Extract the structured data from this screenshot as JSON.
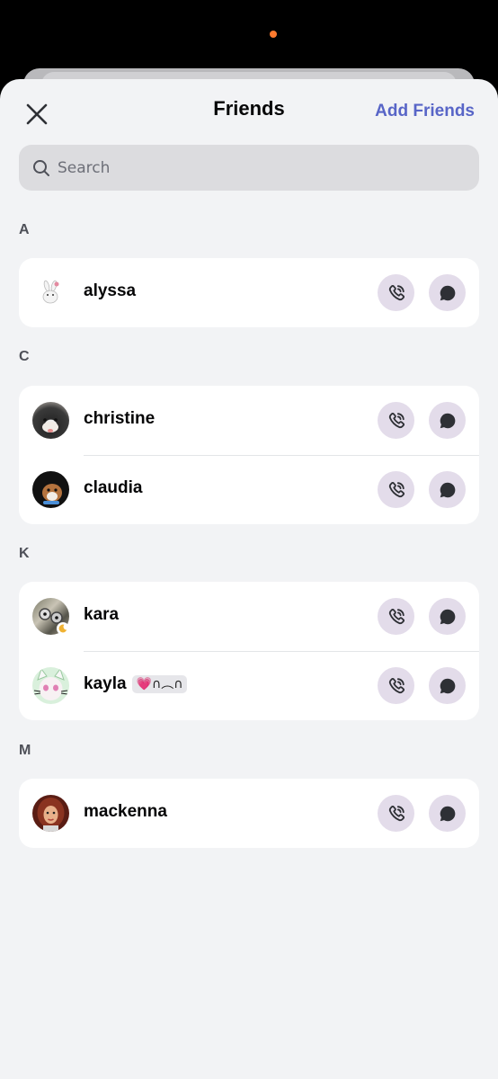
{
  "header": {
    "title": "Friends",
    "add_friends_label": "Add Friends"
  },
  "search": {
    "placeholder": "Search"
  },
  "sections": [
    {
      "letter": "A",
      "friends": [
        {
          "name": "alyssa"
        }
      ]
    },
    {
      "letter": "C",
      "friends": [
        {
          "name": "christine"
        },
        {
          "name": "claudia"
        }
      ]
    },
    {
      "letter": "K",
      "friends": [
        {
          "name": "kara",
          "status": "idle"
        },
        {
          "name": "kayla",
          "badge": "💗∩︵∩"
        }
      ]
    },
    {
      "letter": "M",
      "friends": [
        {
          "name": "mackenna"
        }
      ]
    }
  ],
  "colors": {
    "accent": "#5865c7",
    "action_button_bg": "#e3dcea",
    "sheet_bg": "#f2f3f5",
    "idle_status": "#f0b232"
  }
}
